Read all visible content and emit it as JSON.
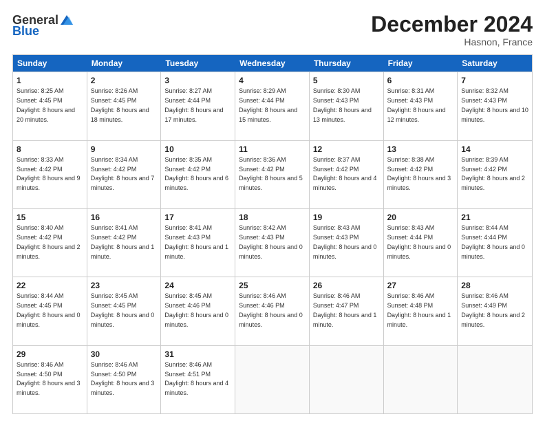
{
  "header": {
    "logo_general": "General",
    "logo_blue": "Blue",
    "title": "December 2024",
    "location": "Hasnon, France"
  },
  "days": [
    "Sunday",
    "Monday",
    "Tuesday",
    "Wednesday",
    "Thursday",
    "Friday",
    "Saturday"
  ],
  "weeks": [
    [
      {
        "day": "1",
        "sunrise": "8:25 AM",
        "sunset": "4:45 PM",
        "daylight": "8 hours and 20 minutes."
      },
      {
        "day": "2",
        "sunrise": "8:26 AM",
        "sunset": "4:45 PM",
        "daylight": "8 hours and 18 minutes."
      },
      {
        "day": "3",
        "sunrise": "8:27 AM",
        "sunset": "4:44 PM",
        "daylight": "8 hours and 17 minutes."
      },
      {
        "day": "4",
        "sunrise": "8:29 AM",
        "sunset": "4:44 PM",
        "daylight": "8 hours and 15 minutes."
      },
      {
        "day": "5",
        "sunrise": "8:30 AM",
        "sunset": "4:43 PM",
        "daylight": "8 hours and 13 minutes."
      },
      {
        "day": "6",
        "sunrise": "8:31 AM",
        "sunset": "4:43 PM",
        "daylight": "8 hours and 12 minutes."
      },
      {
        "day": "7",
        "sunrise": "8:32 AM",
        "sunset": "4:43 PM",
        "daylight": "8 hours and 10 minutes."
      }
    ],
    [
      {
        "day": "8",
        "sunrise": "8:33 AM",
        "sunset": "4:42 PM",
        "daylight": "8 hours and 9 minutes."
      },
      {
        "day": "9",
        "sunrise": "8:34 AM",
        "sunset": "4:42 PM",
        "daylight": "8 hours and 7 minutes."
      },
      {
        "day": "10",
        "sunrise": "8:35 AM",
        "sunset": "4:42 PM",
        "daylight": "8 hours and 6 minutes."
      },
      {
        "day": "11",
        "sunrise": "8:36 AM",
        "sunset": "4:42 PM",
        "daylight": "8 hours and 5 minutes."
      },
      {
        "day": "12",
        "sunrise": "8:37 AM",
        "sunset": "4:42 PM",
        "daylight": "8 hours and 4 minutes."
      },
      {
        "day": "13",
        "sunrise": "8:38 AM",
        "sunset": "4:42 PM",
        "daylight": "8 hours and 3 minutes."
      },
      {
        "day": "14",
        "sunrise": "8:39 AM",
        "sunset": "4:42 PM",
        "daylight": "8 hours and 2 minutes."
      }
    ],
    [
      {
        "day": "15",
        "sunrise": "8:40 AM",
        "sunset": "4:42 PM",
        "daylight": "8 hours and 2 minutes."
      },
      {
        "day": "16",
        "sunrise": "8:41 AM",
        "sunset": "4:42 PM",
        "daylight": "8 hours and 1 minute."
      },
      {
        "day": "17",
        "sunrise": "8:41 AM",
        "sunset": "4:43 PM",
        "daylight": "8 hours and 1 minute."
      },
      {
        "day": "18",
        "sunrise": "8:42 AM",
        "sunset": "4:43 PM",
        "daylight": "8 hours and 0 minutes."
      },
      {
        "day": "19",
        "sunrise": "8:43 AM",
        "sunset": "4:43 PM",
        "daylight": "8 hours and 0 minutes."
      },
      {
        "day": "20",
        "sunrise": "8:43 AM",
        "sunset": "4:44 PM",
        "daylight": "8 hours and 0 minutes."
      },
      {
        "day": "21",
        "sunrise": "8:44 AM",
        "sunset": "4:44 PM",
        "daylight": "8 hours and 0 minutes."
      }
    ],
    [
      {
        "day": "22",
        "sunrise": "8:44 AM",
        "sunset": "4:45 PM",
        "daylight": "8 hours and 0 minutes."
      },
      {
        "day": "23",
        "sunrise": "8:45 AM",
        "sunset": "4:45 PM",
        "daylight": "8 hours and 0 minutes."
      },
      {
        "day": "24",
        "sunrise": "8:45 AM",
        "sunset": "4:46 PM",
        "daylight": "8 hours and 0 minutes."
      },
      {
        "day": "25",
        "sunrise": "8:46 AM",
        "sunset": "4:46 PM",
        "daylight": "8 hours and 0 minutes."
      },
      {
        "day": "26",
        "sunrise": "8:46 AM",
        "sunset": "4:47 PM",
        "daylight": "8 hours and 1 minute."
      },
      {
        "day": "27",
        "sunrise": "8:46 AM",
        "sunset": "4:48 PM",
        "daylight": "8 hours and 1 minute."
      },
      {
        "day": "28",
        "sunrise": "8:46 AM",
        "sunset": "4:49 PM",
        "daylight": "8 hours and 2 minutes."
      }
    ],
    [
      {
        "day": "29",
        "sunrise": "8:46 AM",
        "sunset": "4:50 PM",
        "daylight": "8 hours and 3 minutes."
      },
      {
        "day": "30",
        "sunrise": "8:46 AM",
        "sunset": "4:50 PM",
        "daylight": "8 hours and 3 minutes."
      },
      {
        "day": "31",
        "sunrise": "8:46 AM",
        "sunset": "4:51 PM",
        "daylight": "8 hours and 4 minutes."
      },
      null,
      null,
      null,
      null
    ]
  ]
}
